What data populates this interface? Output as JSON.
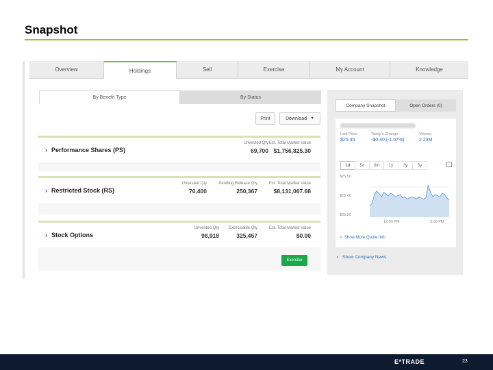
{
  "slide": {
    "title": "Snapshot",
    "page_number": "23",
    "logo": "E*TRADE"
  },
  "nav": {
    "tabs": [
      "Overview",
      "Holdings",
      "Sell",
      "Exercise",
      "My Account",
      "Knowledge"
    ],
    "active": "Holdings"
  },
  "subtabs": [
    "By Benefit Type",
    "By Status"
  ],
  "toolbar": {
    "print_label": "Print",
    "download_label": "Download"
  },
  "cards": [
    {
      "name": "Performance Shares (PS)",
      "metrics": [
        {
          "label": "Unvested Qty",
          "value": "69,700"
        },
        {
          "label": "Est. Total Market Value",
          "value": "$1,756,825.30"
        }
      ]
    },
    {
      "name": "Restricted Stock (RS)",
      "metrics": [
        {
          "label": "Unvested Qty",
          "value": "70,400"
        },
        {
          "label": "Pending Release Qty",
          "value": "250,367"
        },
        {
          "label": "Est. Total Market Value",
          "value": "$8,131,067.68"
        }
      ]
    },
    {
      "name": "Stock Options",
      "metrics": [
        {
          "label": "Unvested Qty",
          "value": "98,918"
        },
        {
          "label": "Exercisable Qty",
          "value": "325,457"
        },
        {
          "label": "Est. Total Market Value",
          "value": "$0.00"
        }
      ]
    }
  ],
  "exercise_label": "Exercise",
  "right": {
    "tabs": [
      "Company Snapshot",
      "Open Orders (0)"
    ],
    "quote": [
      {
        "label": "Last Price",
        "value": "$25.35"
      },
      {
        "label": "Today's Change",
        "value": "-$0.40 (-1.07%)"
      },
      {
        "label": "Volume",
        "value": "2.23M"
      }
    ],
    "ranges": [
      "1d",
      "5d",
      "3m",
      "1y",
      "3y",
      "5y"
    ],
    "active_range": "1d",
    "more_quote": "Show More Quote Info",
    "company_news": "Show Company News"
  },
  "chart_data": {
    "type": "area",
    "y_ticks": [
      "$25.50",
      "$25.40",
      "$25.20"
    ],
    "x_ticks": [
      "12:00 PM",
      "3:00 PM"
    ],
    "ylim": [
      25.2,
      25.55
    ],
    "values": [
      25.3,
      25.32,
      25.4,
      25.43,
      25.41,
      25.38,
      25.42,
      25.4,
      25.39,
      25.41,
      25.4,
      25.38,
      25.39,
      25.4,
      25.37,
      25.38,
      25.36,
      25.37,
      25.38,
      25.37,
      25.36,
      25.38,
      25.37,
      25.36,
      25.37,
      25.48,
      25.42,
      25.38,
      25.4,
      25.39,
      25.38,
      25.41,
      25.4,
      25.37,
      25.35
    ],
    "colors": {
      "fill": "#cfe0f3",
      "line": "#5b8fcf"
    }
  }
}
